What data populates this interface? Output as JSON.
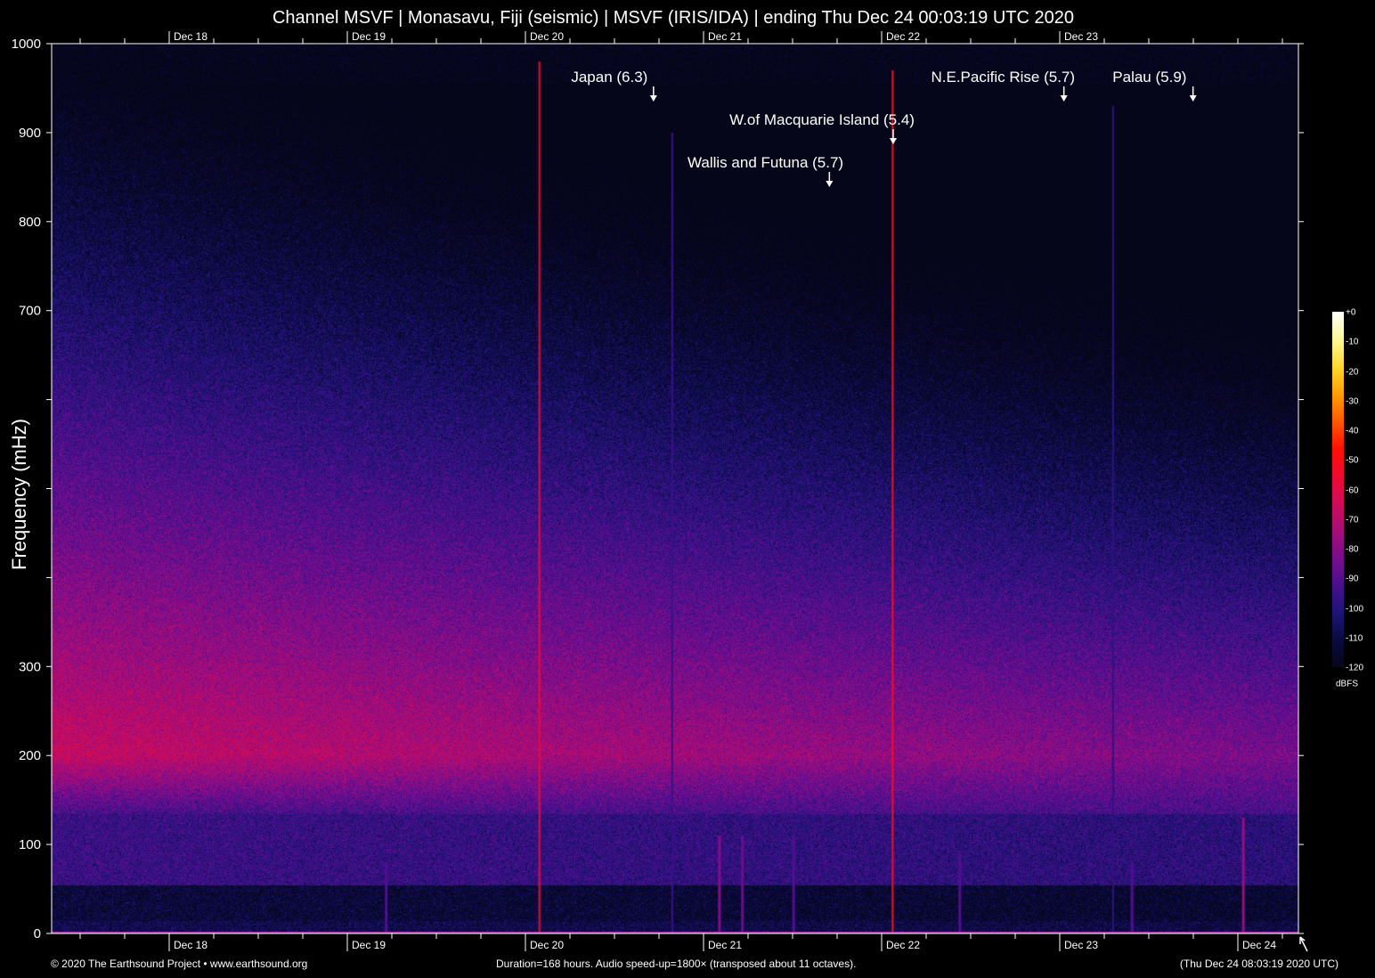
{
  "chart_data": {
    "type": "heatmap",
    "title": "Channel MSVF | Monasavu, Fiji (seismic) | MSVF (IRIS/IDA) | ending Thu Dec 24 00:03:19 UTC 2020",
    "ylabel": "Frequency (mHz)",
    "ylim": [
      0,
      1000
    ],
    "y_ticks": [
      0,
      100,
      200,
      300,
      400,
      500,
      600,
      700,
      800,
      900,
      1000
    ],
    "y_tick_labels": [
      "0",
      "100",
      "200",
      "300",
      "",
      "",
      "",
      "700",
      "800",
      "900",
      "1000"
    ],
    "x_range_hours": [
      0,
      168
    ],
    "x_tick_labels": [
      "Dec 18",
      "Dec 19",
      "Dec 20",
      "Dec 21",
      "Dec 22",
      "Dec 23",
      "Dec 24"
    ],
    "x_tick_hours": [
      15.84,
      39.84,
      63.84,
      87.84,
      111.84,
      135.84,
      159.84
    ],
    "x_top_tick_labels": [
      "Dec 18",
      "Dec 19",
      "Dec 20",
      "Dec 21",
      "Dec 22",
      "Dec 23"
    ],
    "colorbar": {
      "label": "dBFS",
      "range": [
        -120,
        0
      ],
      "ticks": [
        "+0",
        "-10",
        "-20",
        "-30",
        "-40",
        "-50",
        "-60",
        "-70",
        "-80",
        "-90",
        "-100",
        "-110",
        "-120"
      ],
      "colors": [
        "#06061a",
        "#0a0a40",
        "#1e1478",
        "#4a0f90",
        "#7a0d8c",
        "#a80d78",
        "#d00c58",
        "#f00a30",
        "#ff1000",
        "#ff5a00",
        "#ffa000",
        "#ffd830",
        "#fff898",
        "#ffffff"
      ]
    },
    "annotations": [
      {
        "label": "Japan (6.3)",
        "hour": 81.1
      },
      {
        "label": "W.of Macquarie Island (5.4)",
        "hour": 113.4
      },
      {
        "label": "Wallis and Futuna (5.7)",
        "hour": 104.8
      },
      {
        "label": "N.E.Pacific Rise (5.7)",
        "hour": 136.4
      },
      {
        "label": "Palau (5.9)",
        "hour": 153.8
      }
    ],
    "events": [
      {
        "hour": 65.6,
        "db": -60,
        "fmax": 980
      },
      {
        "hour": 113.2,
        "db": -55,
        "fmax": 970
      },
      {
        "hour": 89.8,
        "db": -85,
        "fmax": 110
      },
      {
        "hour": 92.9,
        "db": -90,
        "fmax": 110
      },
      {
        "hour": 160.4,
        "db": -80,
        "fmax": 130
      },
      {
        "hour": 44.9,
        "db": -95,
        "fmax": 80
      },
      {
        "hour": 99.8,
        "db": -95,
        "fmax": 110
      },
      {
        "hour": 122.2,
        "db": -95,
        "fmax": 90
      },
      {
        "hour": 145.4,
        "db": -95,
        "fmax": 80
      },
      {
        "hour": 83.5,
        "db": -100,
        "fmax": 900
      },
      {
        "hour": 142.9,
        "db": -102,
        "fmax": 930
      }
    ]
  },
  "footer": {
    "copyright": "© 2020 The Earthsound Project • www.earthsound.org",
    "duration": "Duration=168 hours. Audio speed-up=1800× (transposed about 11 octaves).",
    "timestamp": "(Thu Dec 24 08:03:19 2020 UTC)"
  }
}
